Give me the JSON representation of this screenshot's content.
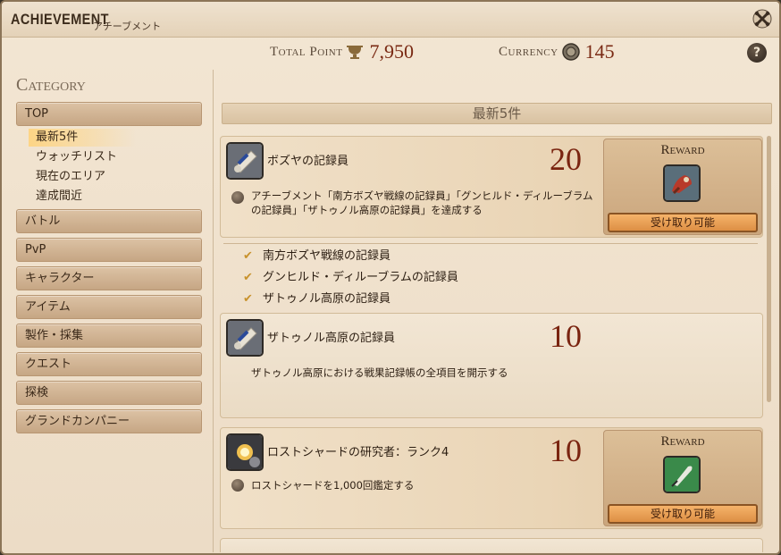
{
  "window": {
    "title_en": "ACHIEVEMENT",
    "title_ja": "アチーブメント"
  },
  "totals": {
    "total_label": "Total Point",
    "total_value": "7,950",
    "currency_label": "Currency",
    "currency_value": "145"
  },
  "sidebar": {
    "heading": "Category",
    "top_label": "TOP",
    "sub_items": [
      "最新5件",
      "ウォッチリスト",
      "現在のエリア",
      "達成間近"
    ],
    "categories": [
      "バトル",
      "PvP",
      "キャラクター",
      "アイテム",
      "製作・採集",
      "クエスト",
      "探検",
      "グランドカンパニー"
    ]
  },
  "main": {
    "header": "最新5件",
    "cards": [
      {
        "name": "ボズヤの記録員",
        "points": "20",
        "desc_line1": "アチーブメント「南方ボズヤ戦線の記録員」「グンヒルド・ディルーブラム",
        "desc_line2": "の記録員」「ザトゥノル高原の記録員」を達成する",
        "reward_title": "Reward",
        "claim_label": "受け取り可能",
        "checklist": [
          "南方ボズヤ戦線の記録員",
          "グンヒルド・ディルーブラムの記録員",
          "ザトゥノル高原の記録員"
        ]
      },
      {
        "name": "ザトゥノル高原の記録員",
        "points": "10",
        "desc_line1": "ザトゥノル高原における戦果記録帳の全項目を開示する"
      },
      {
        "name": "ロストシャードの研究者：ランク4",
        "points": "10",
        "desc_line1": "ロストシャードを1,000回鑑定する",
        "reward_title": "Reward",
        "claim_label": "受け取り可能"
      }
    ]
  },
  "colors": {
    "points": "#7a2410",
    "claim_button": "#f5b36a",
    "highlight": "#ffd278"
  }
}
